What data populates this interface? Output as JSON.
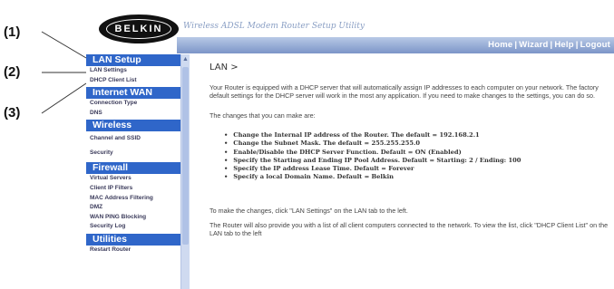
{
  "callouts": [
    "(1)",
    "(2)",
    "(3)"
  ],
  "header": {
    "logo": "BELKIN",
    "utility_title": "Wireless ADSL Modem Router Setup Utility",
    "nav": [
      "Home",
      "Wizard",
      "Help",
      "Logout"
    ]
  },
  "sidebar": {
    "sections": [
      {
        "title": "LAN Setup",
        "items": [
          "LAN Settings",
          "DHCP Client List"
        ]
      },
      {
        "title": "Internet WAN",
        "items": [
          "Connection Type",
          "DNS"
        ]
      },
      {
        "title": "Wireless",
        "items": [
          "Channel and SSID",
          "Security"
        ]
      },
      {
        "title": "Firewall",
        "items": [
          "Virtual Servers",
          "Client IP Filters",
          "MAC Address Filtering",
          "DMZ",
          "WAN PING Blocking",
          "Security Log"
        ]
      },
      {
        "title": "Utilities",
        "items": [
          "Restart Router"
        ]
      }
    ]
  },
  "main": {
    "breadcrumb": "LAN >",
    "intro": "Your Router is equipped with a DHCP server that will automatically assign IP addresses to each computer on your network. The factory default settings for the DHCP server will work in the most any application. If you need to make changes to the settings, you can do so.",
    "changes_heading": "The changes that you can make are:",
    "changes": [
      "Change the Internal IP address of the Router. The default = 192.168.2.1",
      "Change the Subnet Mask. The default = 255.255.255.0",
      "Enable/Disable the DHCP Server Function. Default = ON (Enabled)",
      "Specify the Starting and Ending IP Pool Address. Default = Starting: 2 / Ending: 100",
      "Specify the IP address Lease Time. Default = Forever",
      "Specify a local Domain Name. Default = Belkin"
    ],
    "make_changes": "To make the changes, click \"LAN Settings\" on the LAN tab to the left.",
    "client_list": "The Router will also provide you with a list of all client computers connected to the network. To view the list, click \"DHCP Client List\" on the",
    "client_list_cont": "LAN tab to the left"
  },
  "colors": {
    "section_bg": "#2f66c9",
    "navbar": "#7c95c8"
  }
}
